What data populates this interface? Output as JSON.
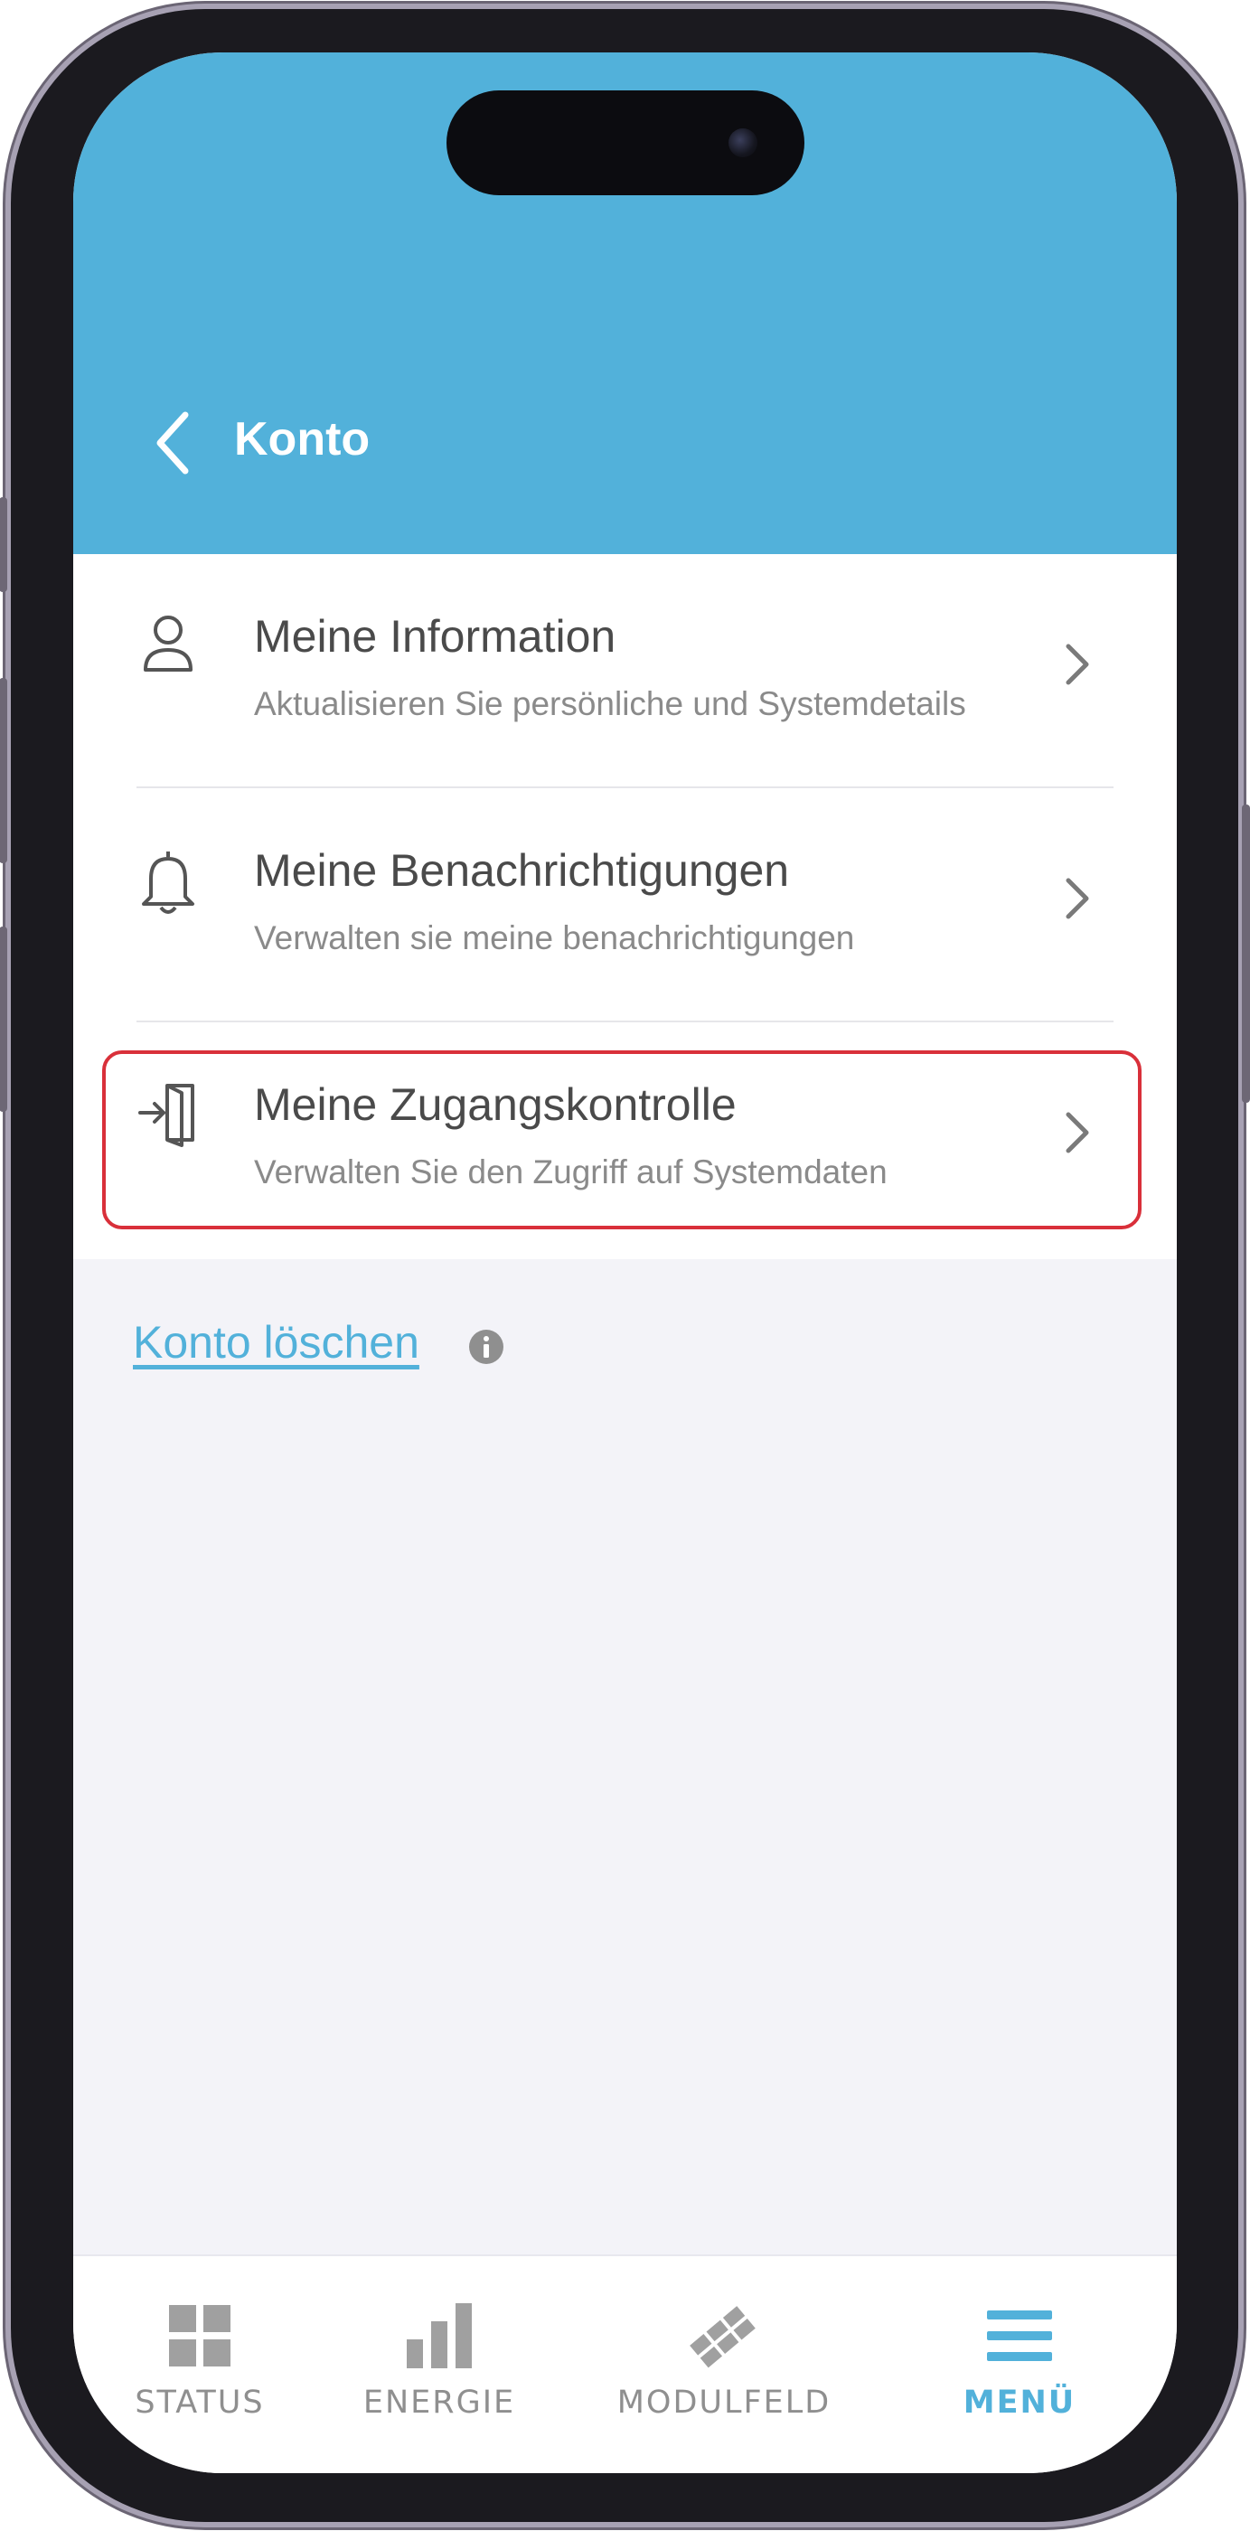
{
  "header": {
    "title": "Konto"
  },
  "menu_items": [
    {
      "title": "Meine Information",
      "subtitle": "Aktualisieren Sie persönliche und Systemdetails",
      "icon": "person-icon"
    },
    {
      "title": "Meine Benachrichtigungen",
      "subtitle": "Verwalten sie meine benachrichtigungen",
      "icon": "bell-icon"
    },
    {
      "title": "Meine Zugangskontrolle",
      "subtitle": "Verwalten Sie den Zugriff auf Systemdaten",
      "icon": "door-enter-icon",
      "highlighted": true
    }
  ],
  "delete_account": {
    "label": "Konto löschen"
  },
  "tabbar": {
    "tabs": [
      {
        "label": "STATUS",
        "icon": "grid-icon",
        "active": false
      },
      {
        "label": "ENERGIE",
        "icon": "bar-chart-icon",
        "active": false
      },
      {
        "label": "MODULFELD",
        "icon": "panels-icon",
        "active": false
      },
      {
        "label": "MENÜ",
        "icon": "hamburger-icon",
        "active": true
      }
    ]
  },
  "colors": {
    "accent": "#52b1da",
    "highlight_border": "#d9303a",
    "background": "#f3f3f8"
  }
}
